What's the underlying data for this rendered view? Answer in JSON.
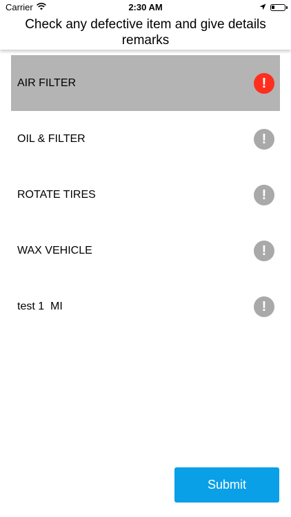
{
  "status_bar": {
    "carrier": "Carrier",
    "time": "2:30 AM",
    "icons": [
      "wifi-icon",
      "location-arrow-icon",
      "battery-icon"
    ]
  },
  "header": {
    "title": "Check any defective item and give details remarks"
  },
  "items": [
    {
      "label": "AIR FILTER",
      "selected": true,
      "icon": "exclamation-icon",
      "icon_color": "#ff2e1f"
    },
    {
      "label": "OIL & FILTER",
      "selected": false,
      "icon": "exclamation-icon",
      "icon_color": "#a9a9a9"
    },
    {
      "label": "ROTATE TIRES",
      "selected": false,
      "icon": "exclamation-icon",
      "icon_color": "#a9a9a9"
    },
    {
      "label": "WAX VEHICLE",
      "selected": false,
      "icon": "exclamation-icon",
      "icon_color": "#a9a9a9"
    },
    {
      "label": "test 1  MI",
      "selected": false,
      "icon": "exclamation-icon",
      "icon_color": "#a9a9a9"
    }
  ],
  "submit": {
    "label": "Submit",
    "color": "#0aa0e8"
  },
  "colors": {
    "selected_row_bg": "#b4b4b4",
    "alert_active": "#ff2e1f",
    "alert_inactive": "#a9a9a9"
  }
}
